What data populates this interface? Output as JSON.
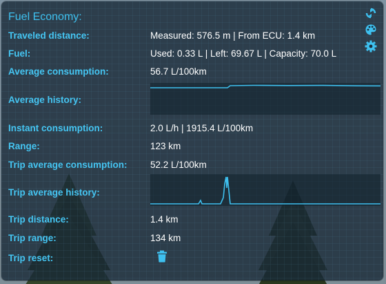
{
  "panel": {
    "title": "Fuel Economy:",
    "tools": [
      {
        "icon": "refresh-icon"
      },
      {
        "icon": "palette-icon"
      },
      {
        "icon": "gear-icon"
      }
    ]
  },
  "rows": {
    "traveled_distance": {
      "label": "Traveled distance:",
      "value": "Measured: 576.5 m | From ECU: 1.4 km"
    },
    "fuel": {
      "label": "Fuel:",
      "value": "Used: 0.33 L | Left: 69.67 L | Capacity: 70.0 L"
    },
    "average_consumption": {
      "label": "Average consumption:",
      "value": "56.7 L/100km"
    },
    "average_history": {
      "label": "Average history:"
    },
    "instant_consumption": {
      "label": "Instant consumption:",
      "value": "2.0 L/h | 1915.4 L/100km"
    },
    "range": {
      "label": "Range:",
      "value": "123 km"
    },
    "trip_average_consumption": {
      "label": "Trip average consumption:",
      "value": "52.2 L/100km"
    },
    "trip_average_history": {
      "label": "Trip average history:"
    },
    "trip_distance": {
      "label": "Trip distance:",
      "value": "1.4 km"
    },
    "trip_range": {
      "label": "Trip range:",
      "value": "134 km"
    },
    "trip_reset": {
      "label": "Trip reset:",
      "icon": "trash-icon"
    }
  },
  "colors": {
    "accent": "#3ec0ef",
    "label": "#45c5f2",
    "value": "#ffffff",
    "graph_line": "#3ec0ef"
  }
}
